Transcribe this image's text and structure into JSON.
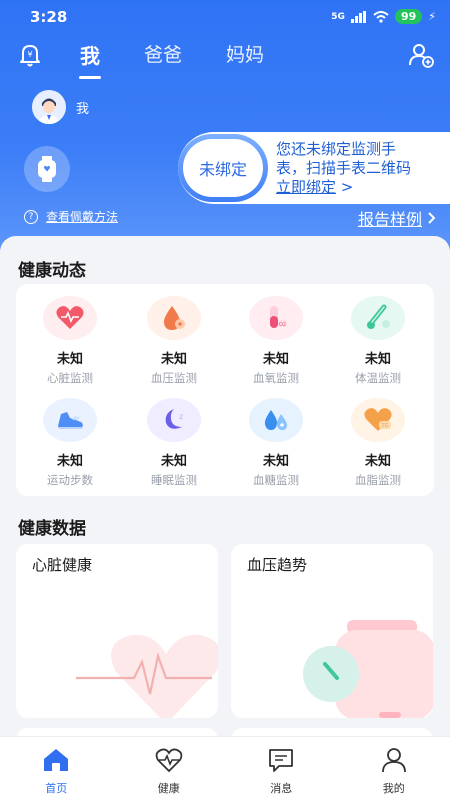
{
  "status": {
    "time": "3:28",
    "network": "5G",
    "battery": "99"
  },
  "tabs": [
    "我",
    "爸爸",
    "妈妈"
  ],
  "profile": {
    "name": "我"
  },
  "wear_link": "查看佩戴方法",
  "bind": {
    "badge": "未绑定",
    "line1": "您还未绑定监测手",
    "line2": "表，扫描手表二维码",
    "link": "立即绑定",
    "arrow": ">"
  },
  "report_link": "报告样例",
  "health_dynamic": {
    "title": "健康动态",
    "items": [
      {
        "value": "未知",
        "label": "心脏监测",
        "icon": "heart-icon"
      },
      {
        "value": "未知",
        "label": "血压监测",
        "icon": "blood-drop-icon"
      },
      {
        "value": "未知",
        "label": "血氧监测",
        "icon": "test-tube-icon"
      },
      {
        "value": "未知",
        "label": "体温监测",
        "icon": "thermometer-icon"
      },
      {
        "value": "未知",
        "label": "运动步数",
        "icon": "shoe-icon"
      },
      {
        "value": "未知",
        "label": "睡眠监测",
        "icon": "moon-icon"
      },
      {
        "value": "未知",
        "label": "血糖监测",
        "icon": "drops-icon"
      },
      {
        "value": "未知",
        "label": "血脂监测",
        "icon": "heart-lipid-icon"
      }
    ]
  },
  "health_data": {
    "title": "健康数据",
    "cards": [
      {
        "title": "心脏健康"
      },
      {
        "title": "血压趋势"
      }
    ]
  },
  "tabbar": [
    {
      "label": "首页",
      "icon": "home-icon",
      "active": true
    },
    {
      "label": "健康",
      "icon": "heartbeat-icon",
      "active": false
    },
    {
      "label": "消息",
      "icon": "message-icon",
      "active": false
    },
    {
      "label": "我的",
      "icon": "person-icon",
      "active": false
    }
  ],
  "colors": {
    "primary": "#2f73f5",
    "active_tab": "#2f6ff0"
  }
}
